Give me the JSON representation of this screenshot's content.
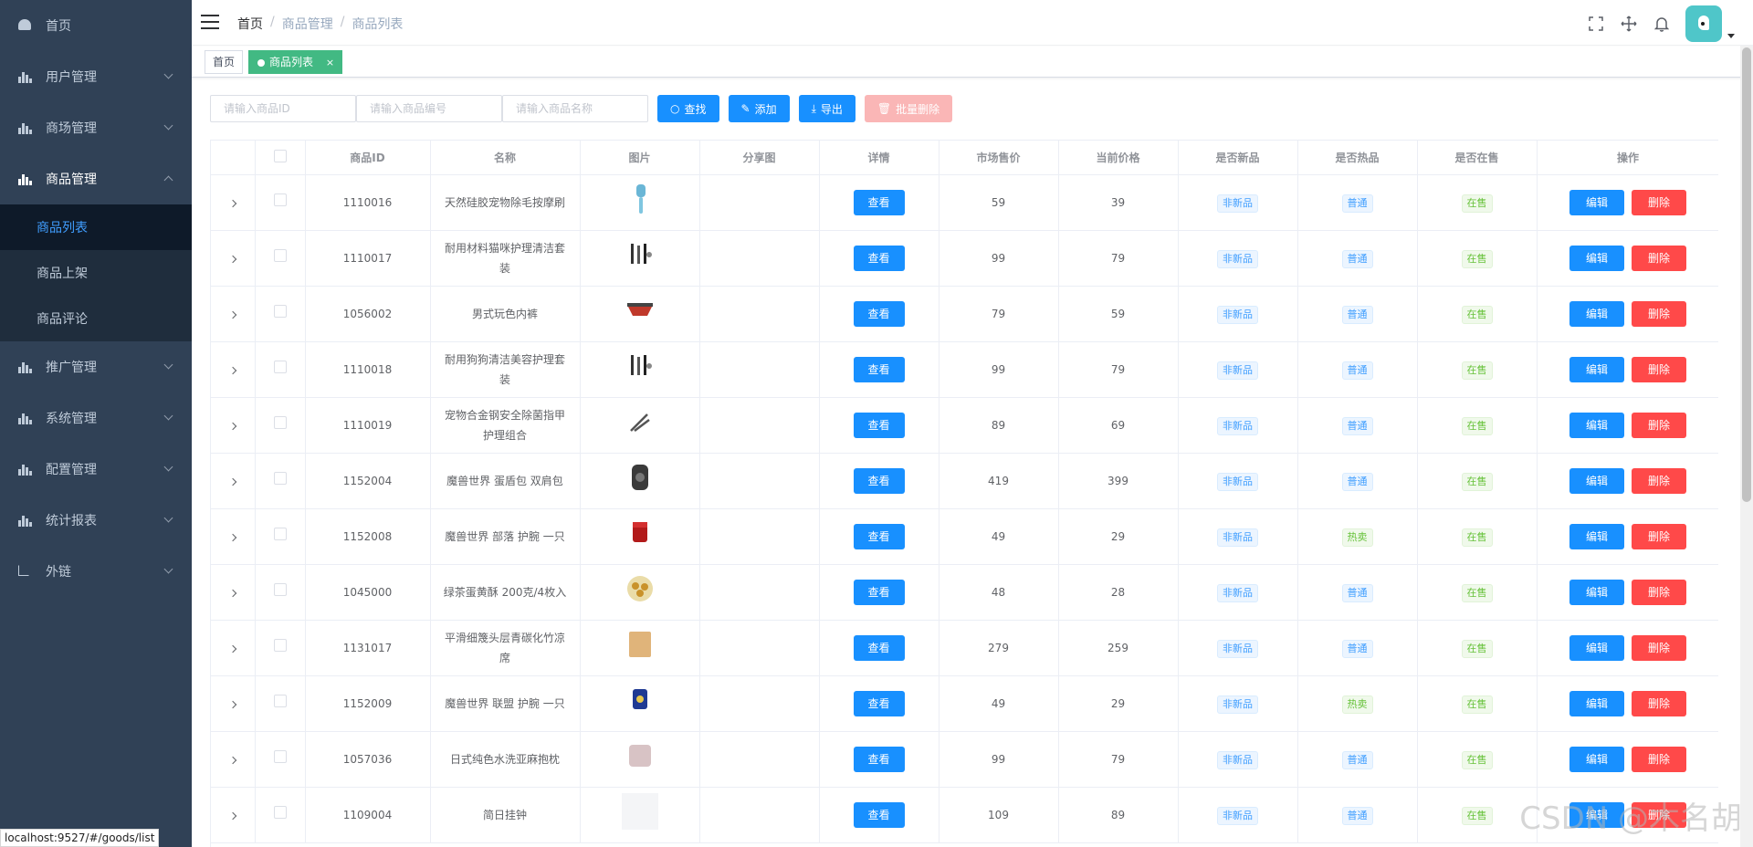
{
  "sidebar": {
    "items": [
      {
        "label": "首页",
        "icon": "dashboard-icon"
      },
      {
        "label": "用户管理",
        "icon": "chart-icon"
      },
      {
        "label": "商场管理",
        "icon": "chart-icon"
      },
      {
        "label": "商品管理",
        "icon": "chart-icon"
      },
      {
        "label": "推广管理",
        "icon": "chart-icon"
      },
      {
        "label": "系统管理",
        "icon": "chart-icon"
      },
      {
        "label": "配置管理",
        "icon": "chart-icon"
      },
      {
        "label": "统计报表",
        "icon": "chart-icon"
      },
      {
        "label": "外链",
        "icon": "external-link-icon"
      }
    ],
    "sub_items": [
      {
        "label": "商品列表"
      },
      {
        "label": "商品上架"
      },
      {
        "label": "商品评论"
      }
    ],
    "colors": {
      "bg": "#304156",
      "submenu_bg": "#1f2d3d",
      "active": "#409eff"
    }
  },
  "navbar": {
    "breadcrumb": [
      "首页",
      "商品管理",
      "商品列表"
    ]
  },
  "tags": {
    "items": [
      {
        "label": "首页"
      },
      {
        "label": "商品列表"
      }
    ],
    "close_symbol": "×"
  },
  "filter": {
    "id_placeholder": "请输入商品ID",
    "sn_placeholder": "请输入商品编号",
    "name_placeholder": "请输入商品名称",
    "search_label": "查找",
    "add_label": "添加",
    "export_label": "导出",
    "batch_delete_label": "批量删除"
  },
  "table": {
    "headers": [
      "商品ID",
      "名称",
      "图片",
      "分享图",
      "详情",
      "市场售价",
      "当前价格",
      "是否新品",
      "是否热品",
      "是否在售",
      "操作"
    ],
    "view_label": "查看",
    "edit_label": "编辑",
    "delete_label": "删除",
    "rows": [
      {
        "id": "1110016",
        "name": "天然硅胶宠物除毛按摩刷",
        "counter": "59",
        "retail": "39",
        "is_new": "非新品",
        "is_hot": "普通",
        "on_sale": "在售",
        "image": "brush-image"
      },
      {
        "id": "1110017",
        "name": "耐用材料猫咪护理清洁套装",
        "counter": "99",
        "retail": "79",
        "is_new": "非新品",
        "is_hot": "普通",
        "on_sale": "在售",
        "image": "tools-image"
      },
      {
        "id": "1056002",
        "name": "男式玩色内裤",
        "counter": "79",
        "retail": "59",
        "is_new": "非新品",
        "is_hot": "普通",
        "on_sale": "在售",
        "image": "underwear-image"
      },
      {
        "id": "1110018",
        "name": "耐用狗狗清洁美容护理套装",
        "counter": "99",
        "retail": "79",
        "is_new": "非新品",
        "is_hot": "普通",
        "on_sale": "在售",
        "image": "tools-image"
      },
      {
        "id": "1110019",
        "name": "宠物合金钢安全除菌指甲护理组合",
        "counter": "89",
        "retail": "69",
        "is_new": "非新品",
        "is_hot": "普通",
        "on_sale": "在售",
        "image": "clipper-image"
      },
      {
        "id": "1152004",
        "name": "魔兽世界 蛋盾包 双肩包",
        "counter": "419",
        "retail": "399",
        "is_new": "非新品",
        "is_hot": "普通",
        "on_sale": "在售",
        "image": "backpack-image"
      },
      {
        "id": "1152008",
        "name": "魔兽世界 部落 护腕 一只",
        "counter": "49",
        "retail": "29",
        "is_new": "非新品",
        "is_hot": "热卖",
        "on_sale": "在售",
        "image": "wristband-red-image"
      },
      {
        "id": "1045000",
        "name": "绿茶蛋黄酥 200克/4枚入",
        "counter": "48",
        "retail": "28",
        "is_new": "非新品",
        "is_hot": "普通",
        "on_sale": "在售",
        "image": "pastry-image"
      },
      {
        "id": "1131017",
        "name": "平滑细篾头层青碳化竹凉席",
        "counter": "279",
        "retail": "259",
        "is_new": "非新品",
        "is_hot": "普通",
        "on_sale": "在售",
        "image": "mat-image"
      },
      {
        "id": "1152009",
        "name": "魔兽世界 联盟 护腕 一只",
        "counter": "49",
        "retail": "29",
        "is_new": "非新品",
        "is_hot": "热卖",
        "on_sale": "在售",
        "image": "wristband-blue-image"
      },
      {
        "id": "1057036",
        "name": "日式纯色水洗亚麻抱枕",
        "counter": "99",
        "retail": "79",
        "is_new": "非新品",
        "is_hot": "普通",
        "on_sale": "在售",
        "image": "pillow-image"
      },
      {
        "id": "1109004",
        "name": "简日挂钟",
        "counter": "109",
        "retail": "89",
        "is_new": "非新品",
        "is_hot": "普通",
        "on_sale": "在售",
        "image": "clock-image"
      }
    ]
  },
  "status_bar": {
    "url": "localhost:9527/#/goods/list"
  },
  "watermark": "CSDN @木名胡"
}
